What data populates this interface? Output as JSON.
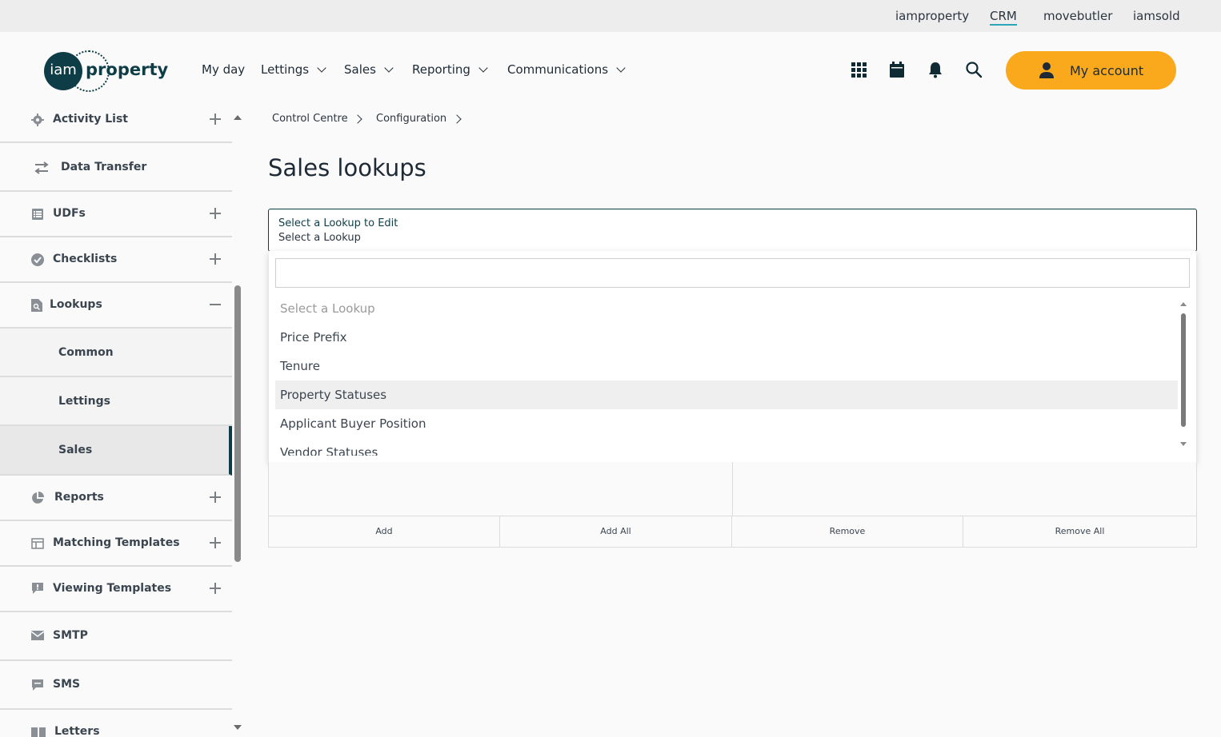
{
  "topbar": {
    "links": [
      "iamproperty",
      "CRM",
      "movebutler",
      "iamsold"
    ],
    "active": "CRM"
  },
  "header": {
    "logo_left": "iam",
    "logo_right": "property",
    "nav": [
      "My day",
      "Lettings",
      "Sales",
      "Reporting",
      "Communications"
    ],
    "icons": [
      "apps-grid-icon",
      "calendar-icon",
      "bell-icon",
      "search-icon"
    ],
    "account_label": "My account"
  },
  "sidebar": {
    "items": [
      {
        "label": "Activity List",
        "icon": "gear-icon",
        "expand": "plus"
      },
      {
        "label": "Data Transfer",
        "icon": "transfer-arrows-icon",
        "expand": ""
      },
      {
        "label": "UDFs",
        "icon": "list-icon",
        "expand": "plus"
      },
      {
        "label": "Checklists",
        "icon": "check-circle-icon",
        "expand": "plus"
      },
      {
        "label": "Lookups",
        "icon": "file-search-icon",
        "expand": "minus"
      },
      {
        "label": "Common"
      },
      {
        "label": "Lettings"
      },
      {
        "label": "Sales",
        "active": true
      },
      {
        "label": "Reports",
        "icon": "pie-chart-icon",
        "expand": "plus"
      },
      {
        "label": "Matching Templates",
        "icon": "template-icon",
        "expand": "plus"
      },
      {
        "label": "Viewing Templates",
        "icon": "alert-message-icon",
        "expand": "plus"
      },
      {
        "label": "SMTP",
        "icon": "envelope-icon",
        "expand": ""
      },
      {
        "label": "SMS",
        "icon": "sms-icon",
        "expand": ""
      },
      {
        "label": "Letters",
        "icon": "letters-icon",
        "expand": ""
      }
    ]
  },
  "breadcrumb": [
    "Control Centre",
    "Configuration"
  ],
  "page": {
    "title": "Sales lookups"
  },
  "lookup_select": {
    "label": "Select a Lookup to Edit",
    "value": "Select a Lookup",
    "search_value": "",
    "options": [
      "Select a Lookup",
      "Price Prefix",
      "Tenure",
      "Property Statuses",
      "Applicant Buyer Position",
      "Vendor Statuses"
    ],
    "highlighted": "Property Statuses"
  },
  "list_buttons": [
    "Add",
    "Add All",
    "Remove",
    "Remove All"
  ],
  "colors": {
    "brand_dark": "#0f3d47",
    "accent": "#f9a91b",
    "crm_underline": "#2aa6b8"
  }
}
